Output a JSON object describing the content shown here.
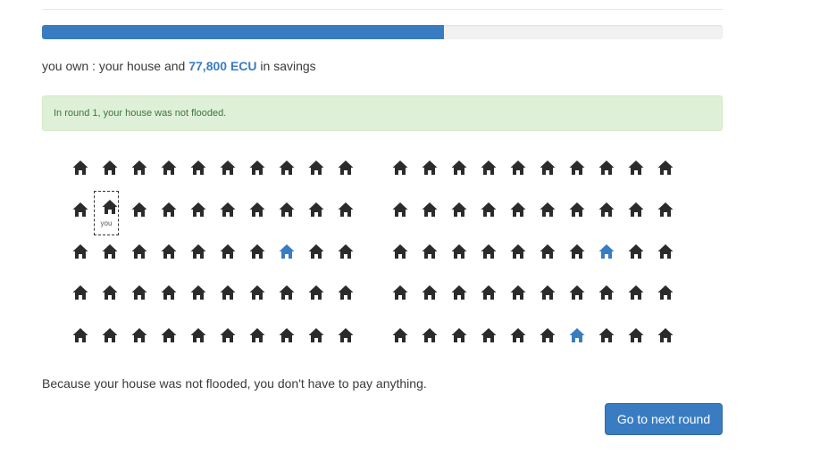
{
  "progress": {
    "fraction": 0.59
  },
  "ownership": {
    "prefix": "you own : your house and ",
    "amount": "77,800 ECU",
    "suffix": " in savings"
  },
  "alert": {
    "message": "In round 1, your house was not flooded."
  },
  "houses": {
    "you_label": "you",
    "rows": 5,
    "cols_per_block": 10,
    "blocks": 2,
    "you_position": {
      "block": 0,
      "row": 1,
      "col": 1
    },
    "flooded": [
      {
        "block": 0,
        "row": 2,
        "col": 7
      },
      {
        "block": 1,
        "row": 2,
        "col": 7
      },
      {
        "block": 1,
        "row": 4,
        "col": 6
      }
    ],
    "colors": {
      "normal": "#2b2b2b",
      "flooded": "#3a7cc2"
    },
    "icon": "house-icon"
  },
  "result": {
    "message": "Because your house was not flooded, you don't have to pay anything."
  },
  "buttons": {
    "next_label": "Go to next round"
  }
}
